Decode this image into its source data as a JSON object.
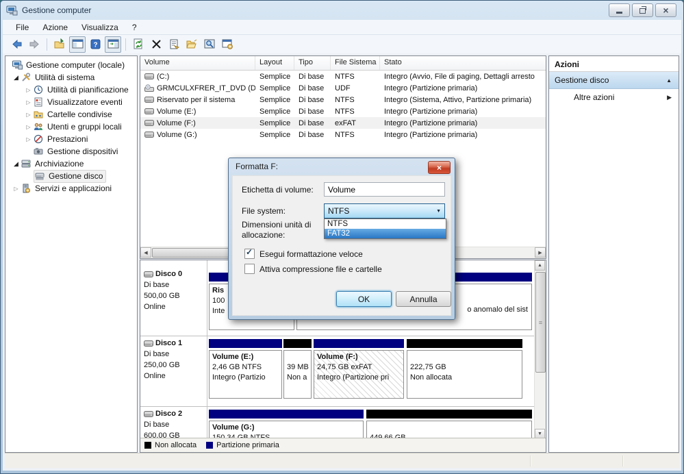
{
  "window": {
    "title": "Gestione computer",
    "control_icons": [
      "minimize-icon",
      "restore-icon",
      "close-icon"
    ]
  },
  "menubar": {
    "items": [
      "File",
      "Azione",
      "Visualizza",
      "?"
    ]
  },
  "toolbar": {
    "icons": [
      "back-icon",
      "forward-icon",
      "export-list-icon",
      "show-console-tree-icon",
      "help-icon",
      "show-action-pane-icon",
      "refresh-icon",
      "delete-icon",
      "properties-icon",
      "open-icon",
      "find-icon",
      "console-settings-icon"
    ]
  },
  "tree": {
    "items": [
      {
        "label": "Gestione computer (locale)",
        "icon": "computer-icon",
        "level": 0,
        "expander": "none",
        "selected": false
      },
      {
        "label": "Utilità di sistema",
        "icon": "system-tools-icon",
        "level": 1,
        "expander": "expanded",
        "selected": false
      },
      {
        "label": "Utilità di pianificazione",
        "icon": "task-scheduler-icon",
        "level": 2,
        "expander": "collapsed",
        "selected": false
      },
      {
        "label": "Visualizzatore eventi",
        "icon": "event-viewer-icon",
        "level": 2,
        "expander": "collapsed",
        "selected": false
      },
      {
        "label": "Cartelle condivise",
        "icon": "shared-folders-icon",
        "level": 2,
        "expander": "collapsed",
        "selected": false
      },
      {
        "label": "Utenti e gruppi locali",
        "icon": "local-users-icon",
        "level": 2,
        "expander": "collapsed",
        "selected": false
      },
      {
        "label": "Prestazioni",
        "icon": "performance-icon",
        "level": 2,
        "expander": "collapsed",
        "selected": false
      },
      {
        "label": "Gestione dispositivi",
        "icon": "device-manager-icon",
        "level": 2,
        "expander": "none",
        "selected": false
      },
      {
        "label": "Archiviazione",
        "icon": "storage-icon",
        "level": 1,
        "expander": "expanded",
        "selected": false
      },
      {
        "label": "Gestione disco",
        "icon": "disk-management-icon",
        "level": 2,
        "expander": "none",
        "selected": true
      },
      {
        "label": "Servizi e applicazioni",
        "icon": "services-icon",
        "level": 1,
        "expander": "collapsed",
        "selected": false
      }
    ]
  },
  "volumes": {
    "columns": [
      "Volume",
      "Layout",
      "Tipo",
      "File Sistema",
      "Stato"
    ],
    "rows": [
      {
        "volume": "(C:)",
        "layout": "Semplice",
        "tipo": "Di base",
        "fs": "NTFS",
        "stato": "Integro (Avvio, File di paging, Dettagli arresto",
        "icon": "disk-volume-icon",
        "selected": false
      },
      {
        "volume": "GRMCULXFRER_IT_DVD (D:)",
        "layout": "Semplice",
        "tipo": "Di base",
        "fs": "UDF",
        "stato": "Integro (Partizione primaria)",
        "icon": "dvd-drive-icon",
        "selected": false
      },
      {
        "volume": "Riservato per il sistema",
        "layout": "Semplice",
        "tipo": "Di base",
        "fs": "NTFS",
        "stato": "Integro (Sistema, Attivo, Partizione primaria)",
        "icon": "disk-volume-icon",
        "selected": false
      },
      {
        "volume": "Volume (E:)",
        "layout": "Semplice",
        "tipo": "Di base",
        "fs": "NTFS",
        "stato": "Integro (Partizione primaria)",
        "icon": "disk-volume-icon",
        "selected": false
      },
      {
        "volume": "Volume (F:)",
        "layout": "Semplice",
        "tipo": "Di base",
        "fs": "exFAT",
        "stato": "Integro (Partizione primaria)",
        "icon": "disk-volume-icon",
        "selected": true
      },
      {
        "volume": "Volume (G:)",
        "layout": "Semplice",
        "tipo": "Di base",
        "fs": "NTFS",
        "stato": "Integro (Partizione primaria)",
        "icon": "disk-volume-icon",
        "selected": false
      }
    ]
  },
  "actions": {
    "header": "Azioni",
    "group": "Gestione disco",
    "item": "Altre azioni"
  },
  "disks": [
    {
      "name": "Disco 0",
      "type": "Di base",
      "size": "500,00 GB",
      "status": "Online",
      "partitions": [
        {
          "fragment_title": "Ris",
          "fragment_line2": "100",
          "fragment_line3": "Inte",
          "bar_color": "#000080"
        },
        {
          "fragment_line3": "o anomalo del sist",
          "bar_color": "#000080"
        }
      ]
    },
    {
      "name": "Disco 1",
      "type": "Di base",
      "size": "250,00 GB",
      "status": "Online",
      "partitions": [
        {
          "title": "Volume (E:)",
          "size": "2,46 GB NTFS",
          "status": "Integro (Partizio",
          "bar_color": "#000080",
          "hatched": false
        },
        {
          "size": "39 MB",
          "status": "Non a",
          "bar_color": "#000000",
          "hatched": false
        },
        {
          "title": "Volume (F:)",
          "size": "24,75 GB exFAT",
          "status": "Integro (Partizione pri",
          "bar_color": "#000080",
          "hatched": true
        },
        {
          "size": "222,75 GB",
          "status": "Non allocata",
          "bar_color": "#000000",
          "hatched": false
        }
      ]
    },
    {
      "name": "Disco 2",
      "type": "Di base",
      "size": "600,00 GB",
      "partitions": [
        {
          "title": "Volume (G:)",
          "size": "150,34 GB NTFS",
          "bar_color": "#000080",
          "hatched": false
        },
        {
          "size": "449,66 GB",
          "bar_color": "#000000",
          "hatched": false
        }
      ]
    }
  ],
  "legend": {
    "items": [
      {
        "label": "Non allocata",
        "color": "#000000"
      },
      {
        "label": "Partizione primaria",
        "color": "#000080"
      }
    ]
  },
  "dialog": {
    "title": "Formatta F:",
    "fields": {
      "volume_label": {
        "label": "Etichetta di volume:",
        "value": "Volume"
      },
      "file_system": {
        "label": "File system:",
        "value": "NTFS",
        "options": [
          "NTFS",
          "FAT32"
        ],
        "highlighted_option": "FAT32"
      },
      "allocation_unit": {
        "label_line1": "Dimensioni unità di",
        "label_line2": "allocazione:"
      }
    },
    "checkboxes": [
      {
        "label": "Esegui formattazione veloce",
        "checked": true
      },
      {
        "label": "Attiva compressione file e cartelle",
        "checked": false
      }
    ],
    "buttons": {
      "ok": "OK",
      "cancel": "Annulla"
    }
  },
  "colors": {
    "primary_partition": "#000080",
    "unallocated": "#000000",
    "selection_blue": "#2a76c4"
  }
}
